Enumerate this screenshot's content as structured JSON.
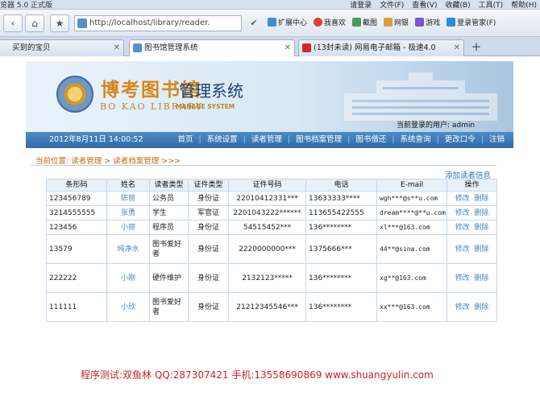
{
  "browser": {
    "app_title": "览器 5.0 正式版",
    "menu": [
      "请登录",
      "文件(F)",
      "查看(V)",
      "收藏(B)",
      "工具(T)",
      "帮助(H)"
    ],
    "address": "http://localhost/library/reader.",
    "extensions": [
      "扩展中心",
      "我喜欢",
      "截图",
      "网银",
      "游戏",
      "登录管家(F)"
    ],
    "tabs": [
      {
        "label": "买到的宝贝"
      },
      {
        "label": "图书馆管理系统"
      },
      {
        "label": "(13封未读) 网易电子邮箱 - 极速4.0"
      }
    ],
    "tab_add": "+"
  },
  "site": {
    "logo_cn": "博考图书馆",
    "logo_cn_suffix": "管理系统",
    "logo_en": "BO KAO LIBRARY",
    "logo_en_sub": "MANAGE SYSTEM",
    "user_line": "当前登录的用户: admin",
    "date": "2012年8月11日  14:00:52",
    "nav": [
      "首页",
      "系统设置",
      "读者管理",
      "图书档案管理",
      "图书借还",
      "系统查询",
      "更改口令",
      "注销"
    ]
  },
  "page": {
    "breadcrumb": "当前位置: 读者管理 > 读者档案管理 >>>",
    "add_link": "添加读者信息",
    "headers": [
      "条形码",
      "姓名",
      "读者类型",
      "证件类型",
      "证件号码",
      "电话",
      "E-mail",
      "操作"
    ],
    "edit_label": "修改",
    "delete_label": "删除",
    "rows": [
      {
        "barcode": "123456789",
        "name": "陈丽",
        "type": "公务员",
        "id_type": "身份证",
        "id_no": "22010412331***",
        "phone": "13633333****",
        "email": "wgh***@s**u.com",
        "tall": false
      },
      {
        "barcode": "3214555555",
        "name": "张勇",
        "type": "学生",
        "id_type": "军官证",
        "id_no": "2201043222******",
        "phone": "113655422555",
        "email": "dream****@**u.com",
        "tall": false
      },
      {
        "barcode": "123456",
        "name": "小丽",
        "type": "程序员",
        "id_type": "身份证",
        "id_no": "54515452***",
        "phone": "136********",
        "email": "xl***@163.com",
        "tall": false
      },
      {
        "barcode": "13579",
        "name": "纯净水",
        "type": "图书爱好者",
        "id_type": "身份证",
        "id_no": "2220000000***",
        "phone": "1375666***",
        "email": "44**@sina.com",
        "tall": true
      },
      {
        "barcode": "222222",
        "name": "小刚",
        "type": "硬件维护",
        "id_type": "身份证",
        "id_no": "2132123*****",
        "phone": "136********",
        "email": "xg**@163.com",
        "tall": true
      },
      {
        "barcode": "111111",
        "name": "小欣",
        "type": "图书爱好者",
        "id_type": "身份证",
        "id_no": "21212345546***",
        "phone": "136********",
        "email": "xx***@163.com",
        "tall": true
      }
    ],
    "footer": "程序测试:双鱼林 QQ:287307421 手机:13558690869 www.shuangyulin.com"
  },
  "colors": {
    "nav_bg": "#3a78b6",
    "link": "#3d88c0",
    "breadcrumb": "#c06a0a",
    "footer": "#cc2222"
  }
}
